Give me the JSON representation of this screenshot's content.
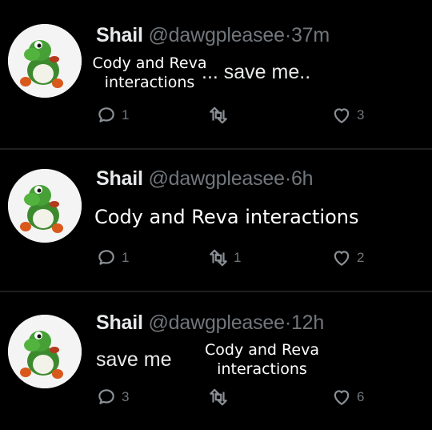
{
  "tweets": [
    {
      "name": "Shail",
      "handle": "@dawgpleasee",
      "dot": "·",
      "time": "37m",
      "text": "... save me..",
      "overlay": "Cody and Reva\ninteractions",
      "replies": "1",
      "retweets": "",
      "likes": "3"
    },
    {
      "name": "Shail",
      "handle": "@dawgpleasee",
      "dot": "·",
      "time": "6h",
      "text": "Cody and Reva interactions",
      "replies": "1",
      "retweets": "1",
      "likes": "2"
    },
    {
      "name": "Shail",
      "handle": "@dawgpleasee",
      "dot": "·",
      "time": "12h",
      "text": "save me",
      "overlay": "Cody and Reva\ninteractions",
      "replies": "3",
      "retweets": "",
      "likes": "6"
    }
  ],
  "icons": {
    "reply": "reply-icon",
    "retweet": "retweet-icon",
    "like": "heart-icon",
    "avatar": "yoshi-avatar"
  },
  "colors": {
    "background": "#000000",
    "text": "#e7e9ea",
    "muted": "#71767b",
    "divider": "#1f1f1f"
  }
}
